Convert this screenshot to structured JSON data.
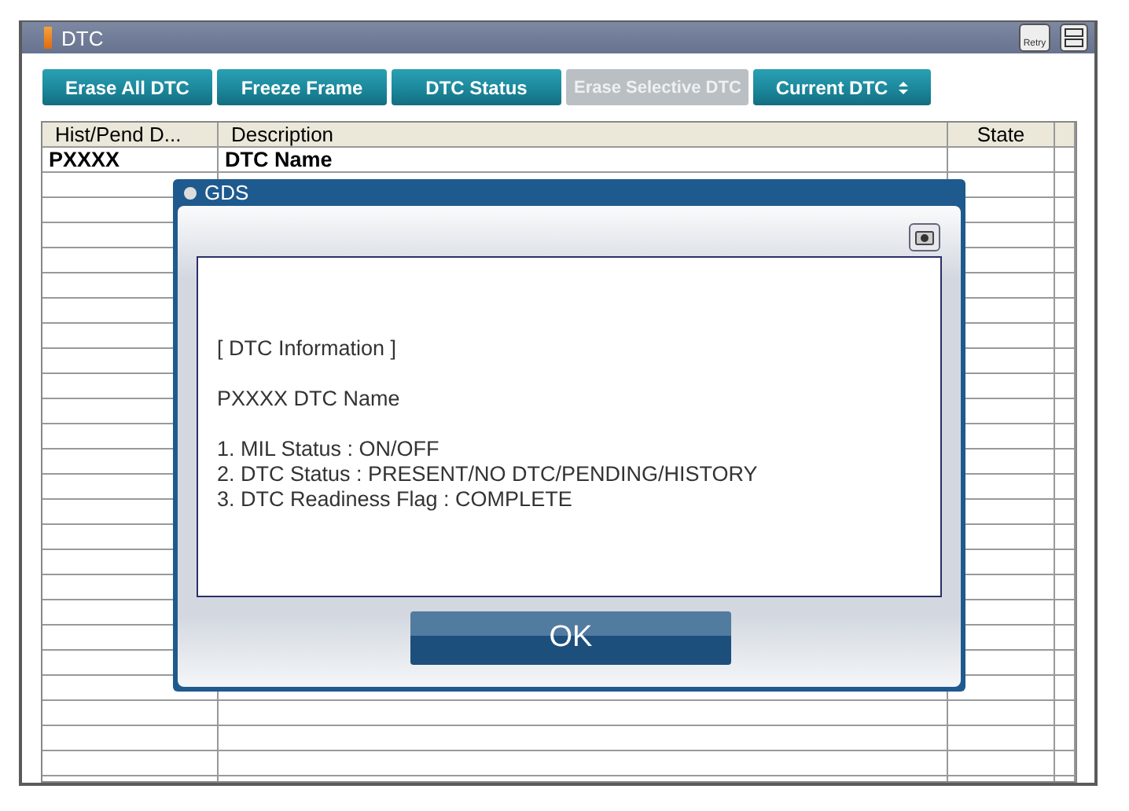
{
  "window": {
    "title": "DTC",
    "retry_label": "Retry"
  },
  "toolbar": [
    {
      "label": "Erase All DTC",
      "kind": "button",
      "disabled": false
    },
    {
      "label": "Freeze Frame",
      "kind": "button",
      "disabled": false
    },
    {
      "label": "DTC Status",
      "kind": "button",
      "disabled": false
    },
    {
      "label": "Erase Selective DTC",
      "kind": "button",
      "disabled": true
    },
    {
      "label": "Current DTC",
      "kind": "dropdown",
      "disabled": false
    }
  ],
  "table": {
    "columns": [
      "Hist/Pend D...",
      "Description",
      "State"
    ],
    "rows": [
      [
        "PXXXX",
        "DTC Name",
        ""
      ]
    ]
  },
  "dialog": {
    "title": "GDS",
    "heading": "[ DTC Information ]",
    "dtc_line": "PXXXX  DTC Name",
    "items": [
      "1. MIL Status : ON/OFF",
      "2. DTC Status : PRESENT/NO DTC/PENDING/HISTORY",
      "3. DTC Readiness Flag : COMPLETE"
    ],
    "ok": "OK"
  }
}
